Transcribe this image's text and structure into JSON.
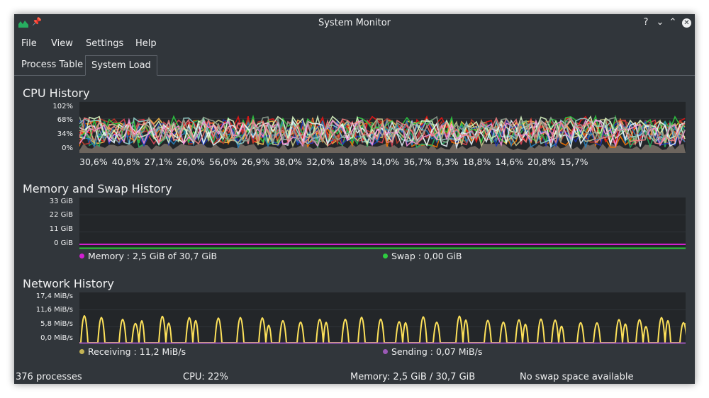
{
  "window": {
    "title": "System Monitor"
  },
  "titlebar_buttons": {
    "help": "?",
    "minimize": "⌄",
    "maximize": "⌃",
    "close": "✕"
  },
  "menu": {
    "items": [
      "File",
      "View",
      "Settings",
      "Help"
    ]
  },
  "tabs": [
    {
      "label": "Process Table",
      "active": false
    },
    {
      "label": "System Load",
      "active": true
    }
  ],
  "cpu": {
    "title": "CPU History",
    "yticks": [
      "102%",
      "68%",
      "34%",
      "0%"
    ],
    "legend": [
      {
        "value": "30,6%",
        "color": "#f67400"
      },
      {
        "value": "40,8%",
        "color": "#da4453"
      },
      {
        "value": "27,1%",
        "color": "#fdbc4b"
      },
      {
        "value": "26,0%",
        "color": "#ed1515"
      },
      {
        "value": "56,0%",
        "color": "#27ae60"
      },
      {
        "value": "26,9%",
        "color": "#1d35b8"
      },
      {
        "value": "38,0%",
        "color": "#c0392b"
      },
      {
        "value": "32,0%",
        "color": "#2ecc40"
      },
      {
        "value": "18,8%",
        "color": "#2980b9"
      },
      {
        "value": "14,0%",
        "color": "#c4c48a"
      },
      {
        "value": "36,7%",
        "color": "#93cec9"
      },
      {
        "value": "8,3%",
        "color": "#d9f5c2"
      },
      {
        "value": "18,8%",
        "color": "#e8f4fb"
      },
      {
        "value": "14,6%",
        "color": "#f48fd8"
      },
      {
        "value": "20,8%",
        "color": "#f08080"
      },
      {
        "value": "15,7%",
        "color": "#8fa08f"
      }
    ]
  },
  "memory": {
    "title": "Memory and Swap History",
    "yticks": [
      "33 GiB",
      "22 GiB",
      "11 GiB",
      "0 GiB"
    ],
    "legend_memory": "Memory : 2,5 GiB of 30,7 GiB",
    "legend_swap": "Swap : 0,00 GiB",
    "memory_color": "#d11fd1",
    "swap_color": "#2ecc40"
  },
  "network": {
    "title": "Network History",
    "yticks": [
      "17,4 MiB/s",
      "11,6 MiB/s",
      "5,8 MiB/s",
      "0,0 MiB/s"
    ],
    "legend_receiving": "Receiving : 11,2 MiB/s",
    "legend_sending": "Sending : 0,07 MiB/s",
    "receiving_color": "#fde15a",
    "sending_color": "#9b59b6"
  },
  "status": {
    "processes": "376 processes",
    "cpu": "CPU: 22%",
    "memory": "Memory: 2,5 GiB / 30,7 GiB",
    "swap": "No swap space available"
  }
}
